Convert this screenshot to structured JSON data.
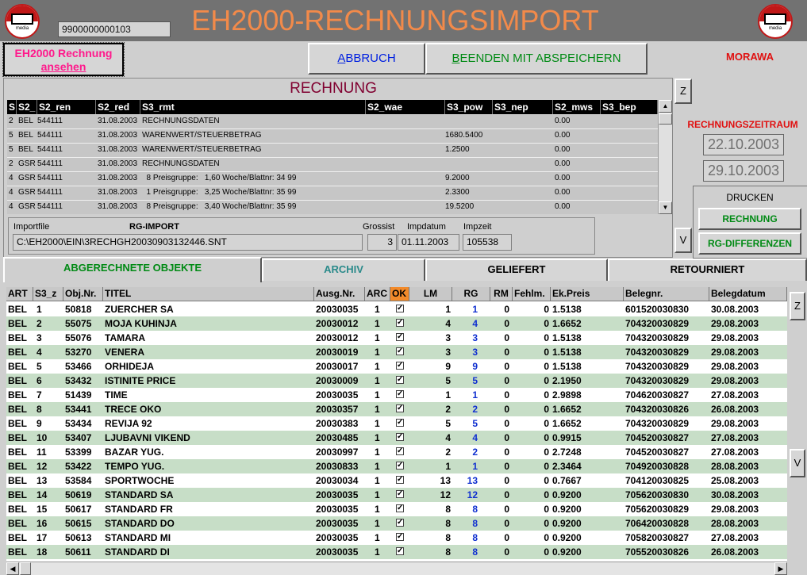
{
  "header": {
    "title": "EH2000-RECHNUNGSIMPORT",
    "ref_number": "9900000000103",
    "logo_text": "media"
  },
  "toolbar": {
    "view_invoice_line1": "EH2000 Rechnung",
    "view_invoice_line2": "ansehen",
    "cancel_first": "A",
    "cancel_rest": "BBRUCH",
    "save_first": "B",
    "save_rest": "EENDEN MIT ABSPEICHERN",
    "user": "MORAWA"
  },
  "invoice": {
    "title": "RECHNUNG",
    "columns": [
      "S",
      "S2_",
      "S2_ren",
      "S2_red",
      "S3_rmt",
      "S2_wae",
      "S3_pow",
      "S3_nep",
      "S2_mws",
      "S3_bep"
    ],
    "rows": [
      [
        "2",
        "BEL",
        "544111",
        "31.08.2003",
        "RECHNUNGSDATEN",
        "",
        "",
        "",
        "0.00",
        ""
      ],
      [
        "5",
        "BEL",
        "544111",
        "31.08.2003",
        "WARENWERT/STEUERBETRAG",
        "",
        "1680.5400",
        "",
        "0.00",
        ""
      ],
      [
        "5",
        "BEL",
        "544111",
        "31.08.2003",
        "WARENWERT/STEUERBETRAG",
        "",
        "1.2500",
        "",
        "0.00",
        ""
      ],
      [
        "2",
        "GSR",
        "544111",
        "31.08.2003",
        "RECHNUNGSDATEN",
        "",
        "",
        "",
        "0.00",
        ""
      ],
      [
        "4",
        "GSR",
        "544111",
        "31.08.2003",
        "  8 Preisgruppe:   1,60 Woche/Blattnr: 34 99",
        "",
        "9.2000",
        "",
        "0.00",
        ""
      ],
      [
        "4",
        "GSR",
        "544111",
        "31.08.2003",
        "  1 Preisgruppe:   3,25 Woche/Blattnr: 35 99",
        "",
        "2.3300",
        "",
        "0.00",
        ""
      ],
      [
        "4",
        "GSR",
        "544111",
        "31.08.2003",
        "  8 Preisgruppe:   3,40 Woche/Blattnr: 35 99",
        "",
        "19.5200",
        "",
        "0.00",
        ""
      ]
    ]
  },
  "import": {
    "file_label": "Importfile",
    "type_label": "RG-IMPORT",
    "file_path": "C:\\EH2000\\EIN\\3RECHGH20030903132446.SNT",
    "grossist_label": "Grossist",
    "grossist": "3",
    "impdatum_label": "Impdatum",
    "impdatum": "01.11.2003",
    "impzeit_label": "Impzeit",
    "impzeit": "105538"
  },
  "side": {
    "z_label": "Z",
    "v_label": "V",
    "period_label": "RECHNUNGSZEITRAUM",
    "date_from": "22.10.2003",
    "date_to": "29.10.2003",
    "print_label": "DRUCKEN",
    "print_invoice": "RECHNUNG",
    "print_diff": "RG-DIFFERENZEN"
  },
  "tabs": [
    "ABGERECHNETE OBJEKTE",
    "ARCHIV",
    "GELIEFERT",
    "RETOURNIERT"
  ],
  "objects": {
    "columns": [
      "ART",
      "S3_z",
      "Obj.Nr.",
      "TITEL",
      "Ausg.Nr.",
      "ARC",
      "OK",
      "LM",
      "RG",
      "RM",
      "Fehlm.",
      "Ek.Preis",
      "Belegnr.",
      "Belegdatum"
    ],
    "check_mark": "✓",
    "rows": [
      [
        "BEL",
        "1",
        "50818",
        "ZUERCHER SA",
        "20030035",
        "1",
        "1",
        "1",
        "0",
        "0",
        "1.5138",
        "601520030830",
        "30.08.2003"
      ],
      [
        "BEL",
        "2",
        "55075",
        "MOJA KUHINJA",
        "20030012",
        "1",
        "4",
        "4",
        "0",
        "0",
        "1.6652",
        "704320030829",
        "29.08.2003"
      ],
      [
        "BEL",
        "3",
        "55076",
        "TAMARA",
        "20030012",
        "1",
        "3",
        "3",
        "0",
        "0",
        "1.5138",
        "704320030829",
        "29.08.2003"
      ],
      [
        "BEL",
        "4",
        "53270",
        "VENERA",
        "20030019",
        "1",
        "3",
        "3",
        "0",
        "0",
        "1.5138",
        "704320030829",
        "29.08.2003"
      ],
      [
        "BEL",
        "5",
        "53466",
        "ORHIDEJA",
        "20030017",
        "1",
        "9",
        "9",
        "0",
        "0",
        "1.5138",
        "704320030829",
        "29.08.2003"
      ],
      [
        "BEL",
        "6",
        "53432",
        "ISTINITE PRICE",
        "20030009",
        "1",
        "5",
        "5",
        "0",
        "0",
        "2.1950",
        "704320030829",
        "29.08.2003"
      ],
      [
        "BEL",
        "7",
        "51439",
        "TIME",
        "20030035",
        "1",
        "1",
        "1",
        "0",
        "0",
        "2.9898",
        "704620030827",
        "27.08.2003"
      ],
      [
        "BEL",
        "8",
        "53441",
        "TRECE OKO",
        "20030357",
        "1",
        "2",
        "2",
        "0",
        "0",
        "1.6652",
        "704320030826",
        "26.08.2003"
      ],
      [
        "BEL",
        "9",
        "53434",
        "REVIJA 92",
        "20030383",
        "1",
        "5",
        "5",
        "0",
        "0",
        "1.6652",
        "704320030829",
        "29.08.2003"
      ],
      [
        "BEL",
        "10",
        "53407",
        "LJUBAVNI VIKEND",
        "20030485",
        "1",
        "4",
        "4",
        "0",
        "0",
        "0.9915",
        "704520030827",
        "27.08.2003"
      ],
      [
        "BEL",
        "11",
        "53399",
        "BAZAR YUG.",
        "20030997",
        "1",
        "2",
        "2",
        "0",
        "0",
        "2.7248",
        "704520030827",
        "27.08.2003"
      ],
      [
        "BEL",
        "12",
        "53422",
        "TEMPO YUG.",
        "20030833",
        "1",
        "1",
        "1",
        "0",
        "0",
        "2.3464",
        "704920030828",
        "28.08.2003"
      ],
      [
        "BEL",
        "13",
        "53584",
        "SPORTWOCHE",
        "20030034",
        "1",
        "13",
        "13",
        "0",
        "0",
        "0.7667",
        "704120030825",
        "25.08.2003"
      ],
      [
        "BEL",
        "14",
        "50619",
        "STANDARD SA",
        "20030035",
        "1",
        "12",
        "12",
        "0",
        "0",
        "0.9200",
        "705620030830",
        "30.08.2003"
      ],
      [
        "BEL",
        "15",
        "50617",
        "STANDARD FR",
        "20030035",
        "1",
        "8",
        "8",
        "0",
        "0",
        "0.9200",
        "705620030829",
        "29.08.2003"
      ],
      [
        "BEL",
        "16",
        "50615",
        "STANDARD DO",
        "20030035",
        "1",
        "8",
        "8",
        "0",
        "0",
        "0.9200",
        "706420030828",
        "28.08.2003"
      ],
      [
        "BEL",
        "17",
        "50613",
        "STANDARD MI",
        "20030035",
        "1",
        "8",
        "8",
        "0",
        "0",
        "0.9200",
        "705820030827",
        "27.08.2003"
      ],
      [
        "BEL",
        "18",
        "50611",
        "STANDARD DI",
        "20030035",
        "1",
        "8",
        "8",
        "0",
        "0",
        "0.9200",
        "705520030826",
        "26.08.2003"
      ]
    ]
  },
  "colors": {
    "title": "#f28a4a",
    "accent_red": "#e01010",
    "accent_green": "#008a14",
    "row_stripe": "#c7dec7",
    "ok_header": "#f28a2a"
  }
}
